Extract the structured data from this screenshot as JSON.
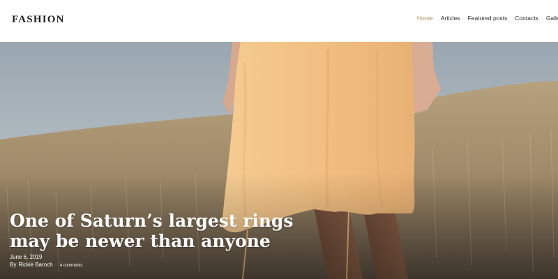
{
  "header": {
    "logo": "FASHION",
    "nav": [
      {
        "label": "Home",
        "active": true
      },
      {
        "label": "Articles",
        "active": false
      },
      {
        "label": "Featured posts",
        "active": false
      },
      {
        "label": "Contacts",
        "active": false
      },
      {
        "label": "Gallery",
        "active": false
      }
    ]
  },
  "hero": {
    "headline_line1": "One of Saturn’s largest rings",
    "headline_line2": "may be newer than anyone",
    "date": "June 6, 2019",
    "by": "By",
    "author": "Rickie Baroch",
    "comments": "4 comments"
  },
  "colors": {
    "accent": "#b38b4d",
    "text": "#1f1f1f",
    "dress": "#f2c48a",
    "sky": "#aeb7be",
    "field": "#a8916c"
  }
}
